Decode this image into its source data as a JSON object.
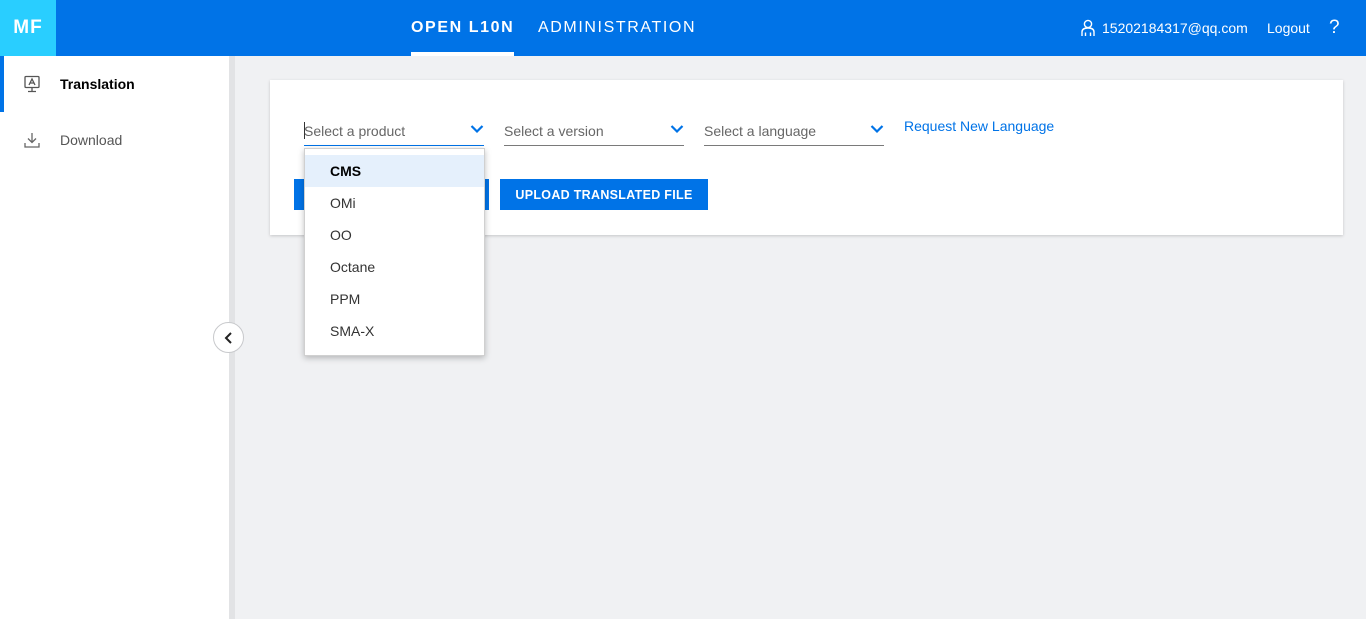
{
  "header": {
    "logo": "MF",
    "tabs": [
      {
        "label": "OPEN L10N",
        "active": true
      },
      {
        "label": "ADMINISTRATION",
        "active": false
      }
    ],
    "user_email": "15202184317@qq.com",
    "logout_label": "Logout",
    "help_icon": "?"
  },
  "sidebar": {
    "items": [
      {
        "label": "Translation",
        "icon": "translation-icon",
        "active": true
      },
      {
        "label": "Download",
        "icon": "download-icon",
        "active": false
      }
    ]
  },
  "main": {
    "product_select": {
      "placeholder": "Select a product"
    },
    "version_select": {
      "placeholder": "Select a version"
    },
    "language_select": {
      "placeholder": "Select a language"
    },
    "request_link": "Request New Language",
    "upload_button": "UPLOAD TRANSLATED FILE",
    "product_options": [
      "CMS",
      "OMi",
      "OO",
      "Octane",
      "PPM",
      "SMA-X"
    ],
    "highlighted_option": "CMS"
  },
  "colors": {
    "header_bg": "#0073e7",
    "logo_bg": "#29ceff",
    "accent": "#0073e7",
    "highlight": "#e5f0fc"
  }
}
